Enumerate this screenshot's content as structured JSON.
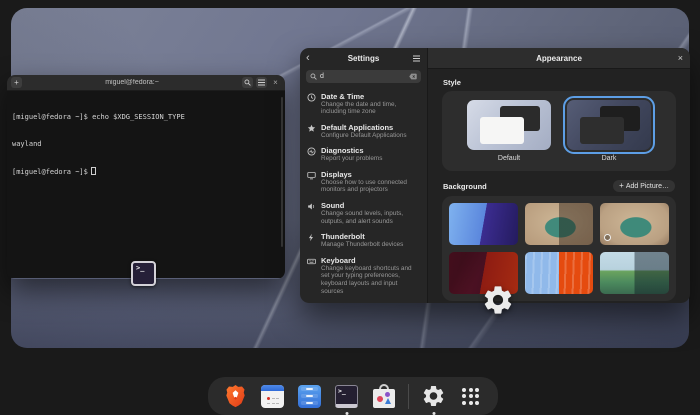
{
  "colors": {
    "accent_blue": "#3584e4",
    "overview_bg": "#1a1a1a",
    "dock_bg": "#2b2b2b",
    "terminal_bg": "#141414",
    "selection_border": "#5d9ee5"
  },
  "terminal": {
    "title": "miguel@fedora:~",
    "new_tab_glyph": "+",
    "close_glyph": "×",
    "app_icon_glyph": ">_",
    "line1": "[miguel@fedora ~]$ echo $XDG_SESSION_TYPE",
    "line2": "wayland",
    "prompt": "[miguel@fedora ~]$"
  },
  "settings": {
    "sidebar": {
      "back_glyph": "‹",
      "title": "Settings",
      "search_value": "d",
      "items": [
        {
          "icon": "clock-icon",
          "title": "Date & Time",
          "subtitle": "Change the date and time, including time zone"
        },
        {
          "icon": "star-icon",
          "title": "Default Applications",
          "subtitle": "Configure Default Applications"
        },
        {
          "icon": "diagnostics-icon",
          "title": "Diagnostics",
          "subtitle": "Report your problems"
        },
        {
          "icon": "display-icon",
          "title": "Displays",
          "subtitle": "Choose how to use connected monitors and projectors"
        },
        {
          "icon": "speaker-icon",
          "title": "Sound",
          "subtitle": "Change sound levels, inputs, outputs, and alert sounds"
        },
        {
          "icon": "thunderbolt-icon",
          "title": "Thunderbolt",
          "subtitle": "Manage Thunderbolt devices"
        },
        {
          "icon": "keyboard-icon",
          "title": "Keyboard",
          "subtitle": "Change keyboard shortcuts and set your typing preferences, keyboard layouts and input sources"
        }
      ]
    },
    "appearance": {
      "title": "Appearance",
      "close_glyph": "×",
      "style_heading": "Style",
      "style_options": [
        {
          "label": "Default",
          "selected": false
        },
        {
          "label": "Dark",
          "selected": true
        }
      ],
      "background_heading": "Background",
      "add_picture_plus": "+",
      "add_picture_label": "Add Picture…",
      "backgrounds": [
        {
          "name": "blobs-blue-purple-split",
          "selected": false
        },
        {
          "name": "painted-landscape-light-dark-split",
          "selected": false
        },
        {
          "name": "painted-landscape",
          "selected": true
        },
        {
          "name": "drips-dark-red-split",
          "selected": false
        },
        {
          "name": "drips-blue-orange-split",
          "selected": false
        },
        {
          "name": "mountain-landscape-light-dark-split",
          "selected": false
        }
      ]
    }
  },
  "dock": {
    "apps": [
      {
        "id": "brave",
        "label": "Brave Browser",
        "running": false
      },
      {
        "id": "calendar",
        "label": "Calendar",
        "running": false
      },
      {
        "id": "files",
        "label": "Files",
        "running": false
      },
      {
        "id": "terminal",
        "label": "Terminal",
        "running": true
      },
      {
        "id": "software",
        "label": "Software",
        "running": false
      },
      {
        "id": "settings",
        "label": "Settings",
        "running": true
      },
      {
        "id": "app-grid",
        "label": "Show Apps",
        "running": false
      }
    ]
  }
}
